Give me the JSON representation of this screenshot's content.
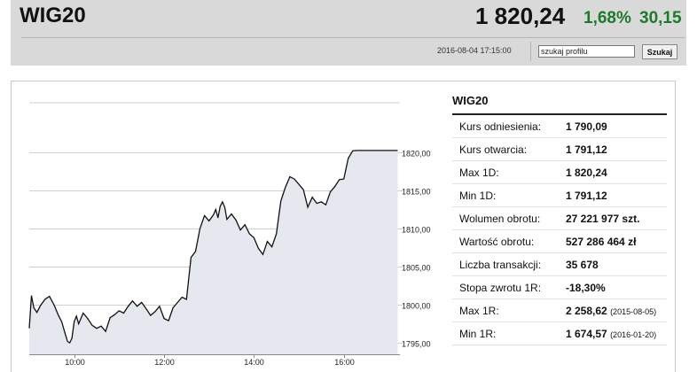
{
  "header": {
    "title": "WIG20",
    "price": "1 820,24",
    "change_pct": "1,68%",
    "change_abs": "30,15",
    "datetime": "2016-08-04 17:15:00",
    "search_value": "szukaj profilu",
    "search_button": "Szukaj"
  },
  "colors": {
    "positive": "#1d7a2a",
    "chart_fill": "#e6e8f0",
    "line": "#111111"
  },
  "info": {
    "title": "WIG20",
    "rows": [
      {
        "label": "Kurs odniesienia:",
        "value": "1 790,09",
        "note": ""
      },
      {
        "label": "Kurs otwarcia:",
        "value": "1 791,12",
        "note": ""
      },
      {
        "label": "Max 1D:",
        "value": "1 820,24",
        "note": ""
      },
      {
        "label": "Min 1D:",
        "value": "1 791,12",
        "note": ""
      },
      {
        "label": "Wolumen obrotu:",
        "value": "27 221 977 szt.",
        "note": ""
      },
      {
        "label": "Wartość obrotu:",
        "value": "527 286 464 zł",
        "note": ""
      },
      {
        "label": "Liczba transakcji:",
        "value": "35 678",
        "note": ""
      },
      {
        "label": "Stopa zwrotu 1R:",
        "value": "-18,30%",
        "note": ""
      },
      {
        "label": "Max 1R:",
        "value": "2 258,62",
        "note": "(2015-08-05)"
      },
      {
        "label": "Min 1R:",
        "value": "1 674,57",
        "note": "(2016-01-20)"
      }
    ]
  },
  "chart_data": {
    "type": "area",
    "y_ticks": [
      1795,
      1800,
      1805,
      1810,
      1815,
      1820
    ],
    "y_tick_labels": [
      "1795,00",
      "1800,00",
      "1805,00",
      "1810,00",
      "1815,00",
      "1820,00"
    ],
    "x_ticks": [
      10,
      12,
      14,
      16
    ],
    "x_tick_labels": [
      "10:00",
      "12:00",
      "14:00",
      "16:00"
    ],
    "ylim": [
      1793.5,
      1826.5
    ],
    "xlim": [
      9.0,
      17.25
    ],
    "grid": true,
    "x": [
      9.0,
      9.05,
      9.1,
      9.17,
      9.25,
      9.35,
      9.45,
      9.55,
      9.65,
      9.72,
      9.8,
      9.85,
      9.9,
      9.95,
      10.0,
      10.05,
      10.1,
      10.2,
      10.3,
      10.4,
      10.5,
      10.6,
      10.7,
      10.8,
      10.9,
      11.0,
      11.1,
      11.2,
      11.3,
      11.4,
      11.5,
      11.6,
      11.7,
      11.8,
      11.9,
      12.0,
      12.1,
      12.2,
      12.3,
      12.4,
      12.5,
      12.6,
      12.7,
      12.8,
      12.9,
      13.0,
      13.1,
      13.15,
      13.2,
      13.25,
      13.3,
      13.35,
      13.4,
      13.5,
      13.6,
      13.7,
      13.8,
      13.9,
      14.0,
      14.1,
      14.2,
      14.3,
      14.4,
      14.5,
      14.6,
      14.7,
      14.8,
      14.9,
      15.0,
      15.1,
      15.2,
      15.3,
      15.4,
      15.5,
      15.6,
      15.7,
      15.8,
      15.9,
      16.0,
      16.1,
      16.2,
      16.3,
      16.4,
      16.5,
      16.6,
      16.7,
      16.8,
      16.9,
      17.0,
      17.1,
      17.2
    ],
    "values": [
      1796.9,
      1801.2,
      1799.6,
      1799.0,
      1799.9,
      1800.7,
      1801.1,
      1800.0,
      1798.6,
      1797.8,
      1796.2,
      1795.2,
      1795.0,
      1795.6,
      1797.8,
      1798.5,
      1797.5,
      1798.9,
      1798.2,
      1797.3,
      1796.9,
      1797.2,
      1796.5,
      1798.3,
      1798.7,
      1799.2,
      1798.9,
      1799.8,
      1800.5,
      1799.8,
      1800.3,
      1799.5,
      1798.6,
      1799.1,
      1799.8,
      1798.2,
      1797.9,
      1799.6,
      1800.3,
      1801.0,
      1800.7,
      1806.2,
      1807.0,
      1810.0,
      1811.7,
      1811.0,
      1811.8,
      1812.5,
      1811.4,
      1812.9,
      1813.5,
      1812.8,
      1811.2,
      1811.9,
      1811.1,
      1809.8,
      1810.5,
      1809.3,
      1808.8,
      1807.4,
      1806.6,
      1808.3,
      1807.6,
      1809.3,
      1813.6,
      1815.4,
      1816.8,
      1816.5,
      1815.8,
      1815.1,
      1812.8,
      1814.1,
      1813.3,
      1813.5,
      1813.1,
      1814.8,
      1815.5,
      1816.4,
      1816.5,
      1819.2,
      1820.2,
      1820.24,
      1820.24,
      1820.24,
      1820.24,
      1820.24,
      1820.24,
      1820.24,
      1820.24,
      1820.24,
      1820.24
    ]
  }
}
